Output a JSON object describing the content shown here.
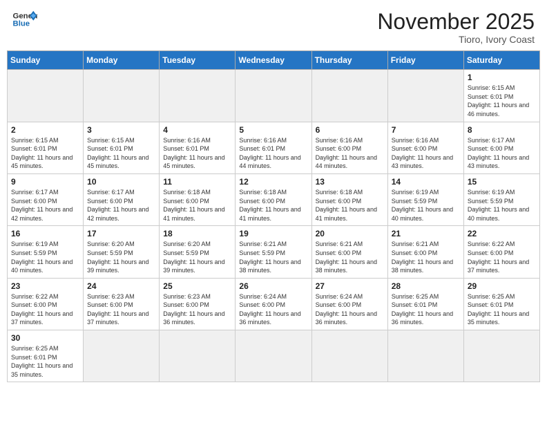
{
  "header": {
    "logo_general": "General",
    "logo_blue": "Blue",
    "month": "November 2025",
    "location": "Tioro, Ivory Coast"
  },
  "weekdays": [
    "Sunday",
    "Monday",
    "Tuesday",
    "Wednesday",
    "Thursday",
    "Friday",
    "Saturday"
  ],
  "weeks": [
    [
      {
        "day": "",
        "empty": true
      },
      {
        "day": "",
        "empty": true
      },
      {
        "day": "",
        "empty": true
      },
      {
        "day": "",
        "empty": true
      },
      {
        "day": "",
        "empty": true
      },
      {
        "day": "",
        "empty": true
      },
      {
        "day": "1",
        "sunrise": "6:15 AM",
        "sunset": "6:01 PM",
        "daylight": "11 hours and 46 minutes."
      }
    ],
    [
      {
        "day": "2",
        "sunrise": "6:15 AM",
        "sunset": "6:01 PM",
        "daylight": "11 hours and 45 minutes."
      },
      {
        "day": "3",
        "sunrise": "6:15 AM",
        "sunset": "6:01 PM",
        "daylight": "11 hours and 45 minutes."
      },
      {
        "day": "4",
        "sunrise": "6:16 AM",
        "sunset": "6:01 PM",
        "daylight": "11 hours and 45 minutes."
      },
      {
        "day": "5",
        "sunrise": "6:16 AM",
        "sunset": "6:01 PM",
        "daylight": "11 hours and 44 minutes."
      },
      {
        "day": "6",
        "sunrise": "6:16 AM",
        "sunset": "6:00 PM",
        "daylight": "11 hours and 44 minutes."
      },
      {
        "day": "7",
        "sunrise": "6:16 AM",
        "sunset": "6:00 PM",
        "daylight": "11 hours and 43 minutes."
      },
      {
        "day": "8",
        "sunrise": "6:17 AM",
        "sunset": "6:00 PM",
        "daylight": "11 hours and 43 minutes."
      }
    ],
    [
      {
        "day": "9",
        "sunrise": "6:17 AM",
        "sunset": "6:00 PM",
        "daylight": "11 hours and 42 minutes."
      },
      {
        "day": "10",
        "sunrise": "6:17 AM",
        "sunset": "6:00 PM",
        "daylight": "11 hours and 42 minutes."
      },
      {
        "day": "11",
        "sunrise": "6:18 AM",
        "sunset": "6:00 PM",
        "daylight": "11 hours and 41 minutes."
      },
      {
        "day": "12",
        "sunrise": "6:18 AM",
        "sunset": "6:00 PM",
        "daylight": "11 hours and 41 minutes."
      },
      {
        "day": "13",
        "sunrise": "6:18 AM",
        "sunset": "6:00 PM",
        "daylight": "11 hours and 41 minutes."
      },
      {
        "day": "14",
        "sunrise": "6:19 AM",
        "sunset": "5:59 PM",
        "daylight": "11 hours and 40 minutes."
      },
      {
        "day": "15",
        "sunrise": "6:19 AM",
        "sunset": "5:59 PM",
        "daylight": "11 hours and 40 minutes."
      }
    ],
    [
      {
        "day": "16",
        "sunrise": "6:19 AM",
        "sunset": "5:59 PM",
        "daylight": "11 hours and 40 minutes."
      },
      {
        "day": "17",
        "sunrise": "6:20 AM",
        "sunset": "5:59 PM",
        "daylight": "11 hours and 39 minutes."
      },
      {
        "day": "18",
        "sunrise": "6:20 AM",
        "sunset": "5:59 PM",
        "daylight": "11 hours and 39 minutes."
      },
      {
        "day": "19",
        "sunrise": "6:21 AM",
        "sunset": "5:59 PM",
        "daylight": "11 hours and 38 minutes."
      },
      {
        "day": "20",
        "sunrise": "6:21 AM",
        "sunset": "6:00 PM",
        "daylight": "11 hours and 38 minutes."
      },
      {
        "day": "21",
        "sunrise": "6:21 AM",
        "sunset": "6:00 PM",
        "daylight": "11 hours and 38 minutes."
      },
      {
        "day": "22",
        "sunrise": "6:22 AM",
        "sunset": "6:00 PM",
        "daylight": "11 hours and 37 minutes."
      }
    ],
    [
      {
        "day": "23",
        "sunrise": "6:22 AM",
        "sunset": "6:00 PM",
        "daylight": "11 hours and 37 minutes."
      },
      {
        "day": "24",
        "sunrise": "6:23 AM",
        "sunset": "6:00 PM",
        "daylight": "11 hours and 37 minutes."
      },
      {
        "day": "25",
        "sunrise": "6:23 AM",
        "sunset": "6:00 PM",
        "daylight": "11 hours and 36 minutes."
      },
      {
        "day": "26",
        "sunrise": "6:24 AM",
        "sunset": "6:00 PM",
        "daylight": "11 hours and 36 minutes."
      },
      {
        "day": "27",
        "sunrise": "6:24 AM",
        "sunset": "6:00 PM",
        "daylight": "11 hours and 36 minutes."
      },
      {
        "day": "28",
        "sunrise": "6:25 AM",
        "sunset": "6:01 PM",
        "daylight": "11 hours and 36 minutes."
      },
      {
        "day": "29",
        "sunrise": "6:25 AM",
        "sunset": "6:01 PM",
        "daylight": "11 hours and 35 minutes."
      }
    ],
    [
      {
        "day": "30",
        "sunrise": "6:25 AM",
        "sunset": "6:01 PM",
        "daylight": "11 hours and 35 minutes."
      },
      {
        "day": "",
        "empty": true
      },
      {
        "day": "",
        "empty": true
      },
      {
        "day": "",
        "empty": true
      },
      {
        "day": "",
        "empty": true
      },
      {
        "day": "",
        "empty": true
      },
      {
        "day": "",
        "empty": true
      }
    ]
  ]
}
